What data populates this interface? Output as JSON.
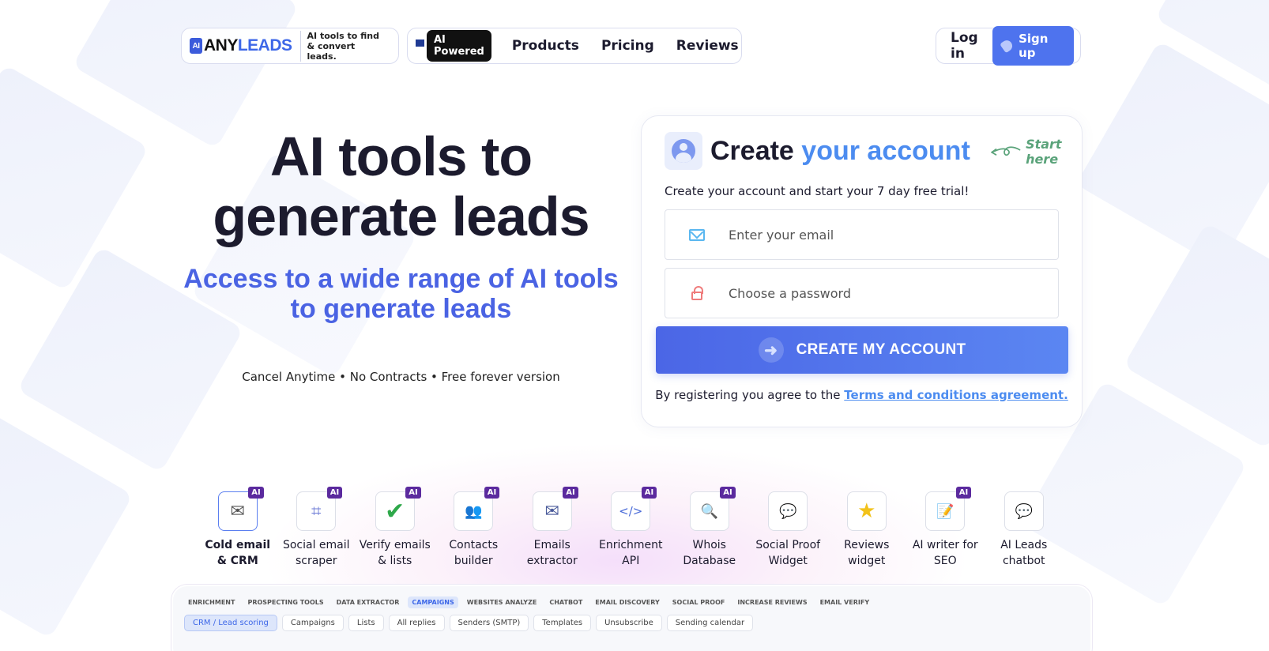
{
  "brand": {
    "logo_ai": "AI",
    "logo_any": "ANY",
    "logo_leads": "LEADS",
    "tagline": "AI tools to find & convert leads."
  },
  "nav": {
    "badge": "AI Powered",
    "links": [
      "Products",
      "Pricing",
      "Reviews"
    ],
    "login": "Log in",
    "signup": "Sign up"
  },
  "hero": {
    "title": "AI tools to generate leads",
    "subtitle": "Access to a wide range of AI tools to generate leads",
    "benefits": "Cancel Anytime • No Contracts • Free forever version"
  },
  "signup_form": {
    "title_plain": "Create",
    "title_accent": "your account",
    "start_hint": "Start here",
    "description": "Create your account and start your 7 day free trial!",
    "email_placeholder": "Enter your email",
    "password_placeholder": "Choose a password",
    "cta_label": "CREATE MY ACCOUNT",
    "terms_prefix": "By registering you agree to the",
    "terms_link": "Terms and conditions agreement."
  },
  "tools": [
    {
      "label": "Cold email & CRM",
      "ai": true,
      "icon": "paper-plane-icon",
      "glyph": "✉"
    },
    {
      "label": "Social email scraper",
      "ai": true,
      "icon": "scraper-icon",
      "glyph": "⌗"
    },
    {
      "label": "Verify emails & lists",
      "ai": true,
      "icon": "checkmark-icon",
      "glyph": "✔"
    },
    {
      "label": "Contacts builder",
      "ai": true,
      "icon": "contacts-icon",
      "glyph": "👥"
    },
    {
      "label": "Emails extractor",
      "ai": true,
      "icon": "envelope-icon",
      "glyph": "✉"
    },
    {
      "label": "Enrichment API",
      "ai": true,
      "icon": "code-icon",
      "glyph": "</>"
    },
    {
      "label": "Whois Database",
      "ai": true,
      "icon": "database-icon",
      "glyph": "🔍"
    },
    {
      "label": "Social Proof Widget",
      "ai": false,
      "icon": "chat-bubble-icon",
      "glyph": "💬"
    },
    {
      "label": "Reviews widget",
      "ai": false,
      "icon": "star-icon",
      "glyph": "★"
    },
    {
      "label": "AI writer for SEO",
      "ai": true,
      "icon": "notepad-icon",
      "glyph": "📝"
    },
    {
      "label": "AI Leads chatbot",
      "ai": false,
      "icon": "chatbot-icon",
      "glyph": "💬"
    }
  ],
  "ai_badge": "AI",
  "preview": {
    "tabs": [
      "ENRICHMENT",
      "PROSPECTING TOOLS",
      "DATA EXTRACTOR",
      "CAMPAIGNS",
      "WEBSITES ANALYZE",
      "CHATBOT",
      "EMAIL DISCOVERY",
      "SOCIAL PROOF",
      "INCREASE REVIEWS",
      "EMAIL VERIFY"
    ],
    "selected_tab": "CAMPAIGNS",
    "subtabs": [
      "CRM / Lead scoring",
      "Campaigns",
      "Lists",
      "All replies",
      "Senders (SMTP)",
      "Templates",
      "Unsubscribe",
      "Sending calendar"
    ],
    "selected_subtab": "CRM / Lead scoring"
  },
  "colors": {
    "brand_blue": "#4b66e6",
    "accent_blue": "#4c8cf0",
    "ai_badge": "#5b2a9e",
    "start_hint_green": "#5aa37a"
  }
}
